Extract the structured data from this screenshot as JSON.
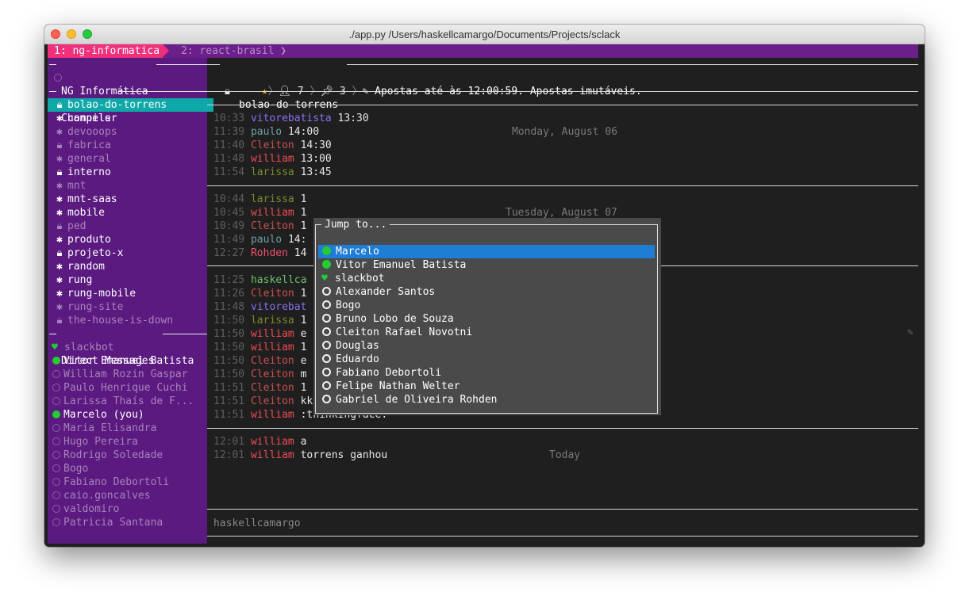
{
  "window": {
    "title": "./app.py  /Users/haskellcamargo/Documents/Projects/sclack"
  },
  "tabs": [
    {
      "label": "1: ng-informatica",
      "active": true
    },
    {
      "label": "2: react-brasil",
      "active": false
    }
  ],
  "sidebar": {
    "workspace": "NG Informática",
    "user": "haskellcamargo",
    "channels_header": "Channels",
    "channels": [
      {
        "name": "bolao-do-torrens",
        "icon": "lock-icon",
        "state": "selected"
      },
      {
        "name": "compiler",
        "icon": "gear-icon",
        "state": "bright"
      },
      {
        "name": "devooops",
        "icon": "gear-icon",
        "state": "dim"
      },
      {
        "name": "fabrica",
        "icon": "lock-icon",
        "state": "dim"
      },
      {
        "name": "general",
        "icon": "gear-icon",
        "state": "dim"
      },
      {
        "name": "interno",
        "icon": "lock-icon",
        "state": "bright"
      },
      {
        "name": "mnt",
        "icon": "gear-icon",
        "state": "dim"
      },
      {
        "name": "mnt-saas",
        "icon": "gear-icon",
        "state": "bright"
      },
      {
        "name": "mobile",
        "icon": "gear-icon",
        "state": "bright"
      },
      {
        "name": "ped",
        "icon": "lock-icon",
        "state": "dim"
      },
      {
        "name": "produto",
        "icon": "gear-icon",
        "state": "bright"
      },
      {
        "name": "projeto-x",
        "icon": "lock-icon",
        "state": "bright"
      },
      {
        "name": "random",
        "icon": "gear-icon",
        "state": "bright"
      },
      {
        "name": "rung",
        "icon": "gear-icon",
        "state": "bright"
      },
      {
        "name": "rung-mobile",
        "icon": "gear-icon",
        "state": "bright"
      },
      {
        "name": "rung-site",
        "icon": "gear-icon",
        "state": "dim"
      },
      {
        "name": "the-house-is-down",
        "icon": "lock-icon",
        "state": "dim"
      }
    ],
    "dm_header": "Direct Messages",
    "dms": [
      {
        "name": "slackbot",
        "status": "heart",
        "state": "dim"
      },
      {
        "name": "Vitor Emanuel Batista",
        "status": "online",
        "state": "bright"
      },
      {
        "name": "William Rozin Gaspar",
        "status": "offline",
        "state": "dim"
      },
      {
        "name": "Paulo Henrique Cuchi",
        "status": "offline",
        "state": "dim"
      },
      {
        "name": "Larissa Thaís de F...",
        "status": "offline",
        "state": "dim"
      },
      {
        "name": "Marcelo (you)",
        "status": "online",
        "state": "bright"
      },
      {
        "name": "Maria Elisandra",
        "status": "offline",
        "state": "dim"
      },
      {
        "name": "Hugo Pereira",
        "status": "offline",
        "state": "dim"
      },
      {
        "name": "Rodrigo Soledade",
        "status": "offline",
        "state": "dim"
      },
      {
        "name": "Bogo",
        "status": "offline",
        "state": "dim"
      },
      {
        "name": "Fabiano Debortoli",
        "status": "offline",
        "state": "dim"
      },
      {
        "name": "caio.goncalves",
        "status": "offline",
        "state": "dim"
      },
      {
        "name": "valdomiro",
        "status": "offline",
        "state": "dim"
      },
      {
        "name": "Patricia Santana",
        "status": "offline",
        "state": "dim"
      }
    ]
  },
  "channel_header": {
    "name": "bolao-do-torrens",
    "members": "7",
    "pins": "3",
    "topic": "Apostas até às 12:00:59. Apostas imutáveis."
  },
  "dates": [
    "Monday, August 06",
    "Tuesday, August 07",
    "Today"
  ],
  "messages_monday": [
    {
      "time": "10:33",
      "user": "vitorebatista",
      "cls": "u-vitor",
      "text": "13:30"
    },
    {
      "time": "11:39",
      "user": "paulo",
      "cls": "u-paulo",
      "text": "14:00"
    },
    {
      "time": "11:40",
      "user": "Cleiton",
      "cls": "u-cleiton",
      "text": "14:30"
    },
    {
      "time": "11:48",
      "user": "william",
      "cls": "u-william",
      "text": "13:00"
    },
    {
      "time": "11:54",
      "user": "larissa",
      "cls": "u-larissa",
      "text": "13:45"
    }
  ],
  "messages_tuesday_a": [
    {
      "time": "10:44",
      "user": "larissa",
      "cls": "u-larissa",
      "text": "1"
    },
    {
      "time": "10:45",
      "user": "william",
      "cls": "u-william",
      "text": "1"
    },
    {
      "time": "10:49",
      "user": "Cleiton",
      "cls": "u-cleiton",
      "text": "1"
    },
    {
      "time": "11:49",
      "user": "paulo",
      "cls": "u-paulo",
      "text": "14:"
    },
    {
      "time": "12:27",
      "user": "Rohden",
      "cls": "u-rohden",
      "text": "14"
    }
  ],
  "messages_tuesday_b": [
    {
      "time": "11:25",
      "user": "haskellca",
      "cls": "u-haskell",
      "text": ""
    },
    {
      "time": "11:26",
      "user": "Cleiton",
      "cls": "u-cleiton",
      "text": "1"
    },
    {
      "time": "11:48",
      "user": "vitorebat",
      "cls": "u-vitor",
      "text": ""
    },
    {
      "time": "11:50",
      "user": "larissa",
      "cls": "u-larissa",
      "text": "1"
    },
    {
      "time": "11:50",
      "user": "william",
      "cls": "u-william",
      "text": "e"
    },
    {
      "time": "11:50",
      "user": "william",
      "cls": "u-william",
      "text": "1"
    },
    {
      "time": "11:50",
      "user": "Cleiton",
      "cls": "u-cleiton",
      "text": "e"
    },
    {
      "time": "11:50",
      "user": "Cleiton",
      "cls": "u-cleiton",
      "text": "m"
    },
    {
      "time": "11:51",
      "user": "Cleiton",
      "cls": "u-cleiton",
      "text": "1"
    },
    {
      "time": "11:51",
      "user": "Cleiton",
      "cls": "u-cleiton",
      "text": "kkkk"
    },
    {
      "time": "11:51",
      "user": "william",
      "cls": "u-william",
      "text": ":thinkingface:"
    }
  ],
  "messages_today": [
    {
      "time": "12:01",
      "user": "william",
      "cls": "u-william",
      "text": "a"
    },
    {
      "time": "12:01",
      "user": "william",
      "cls": "u-william",
      "text": "torrens ganhou"
    }
  ],
  "jump": {
    "title": "Jump to...",
    "items": [
      {
        "name": "Marcelo",
        "status": "online",
        "highlight": true
      },
      {
        "name": "Vitor Emanuel Batista",
        "status": "online",
        "highlight": false
      },
      {
        "name": "slackbot",
        "status": "heart",
        "highlight": false
      },
      {
        "name": "Alexander Santos",
        "status": "offline",
        "highlight": false
      },
      {
        "name": "Bogo",
        "status": "offline",
        "highlight": false
      },
      {
        "name": "Bruno Lobo de Souza",
        "status": "offline",
        "highlight": false
      },
      {
        "name": "Cleiton Rafael Novotni",
        "status": "offline",
        "highlight": false
      },
      {
        "name": "Douglas",
        "status": "offline",
        "highlight": false
      },
      {
        "name": "Eduardo",
        "status": "offline",
        "highlight": false
      },
      {
        "name": "Fabiano Debortoli",
        "status": "offline",
        "highlight": false
      },
      {
        "name": "Felipe Nathan Welter",
        "status": "offline",
        "highlight": false
      },
      {
        "name": "Gabriel de Oliveira Rohden",
        "status": "offline",
        "highlight": false
      }
    ]
  },
  "input": {
    "text": "haskellcamargo"
  },
  "colors": {
    "sidebar_bg": "#5b1a80",
    "tab_active": "#f0307a",
    "selected_channel": "#0fa8a8",
    "highlight": "#1e7dd4",
    "online": "#22cc33"
  }
}
